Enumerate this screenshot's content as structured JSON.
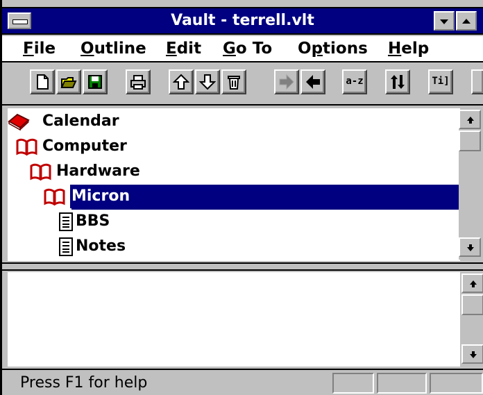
{
  "window": {
    "title": "Vault - terrell.vlt"
  },
  "menu": [
    {
      "label": "File",
      "ul": "F",
      "rest": "ile"
    },
    {
      "label": "Outline",
      "ul": "O",
      "rest": "utline"
    },
    {
      "label": "Edit",
      "ul": "E",
      "rest": "dit"
    },
    {
      "label": "Go To",
      "ul": "G",
      "rest": "o To"
    },
    {
      "label": "Options",
      "pre": "O",
      "ul": "p",
      "rest": "tions"
    },
    {
      "label": "Help",
      "ul": "H",
      "rest": "elp"
    }
  ],
  "toolbar": {
    "sort_label": "a-z",
    "text_label": "Ti]"
  },
  "outline": {
    "items": [
      {
        "label": "Calendar",
        "icon": "closed-book-icon",
        "level": 0
      },
      {
        "label": "Computer",
        "icon": "open-book-icon",
        "level": 0
      },
      {
        "label": "Hardware",
        "icon": "open-book-icon",
        "level": 1
      },
      {
        "label": "Micron",
        "icon": "open-book-icon",
        "level": 2,
        "selected": true
      },
      {
        "label": "BBS",
        "icon": "page-icon",
        "level": 3
      },
      {
        "label": "Notes",
        "icon": "page-icon",
        "level": 3
      }
    ]
  },
  "status": {
    "text": "Press F1 for help"
  },
  "colors": {
    "titlebar": "#000080",
    "face": "#c0c0c0",
    "selection": "#000080",
    "book": "#c00000"
  }
}
